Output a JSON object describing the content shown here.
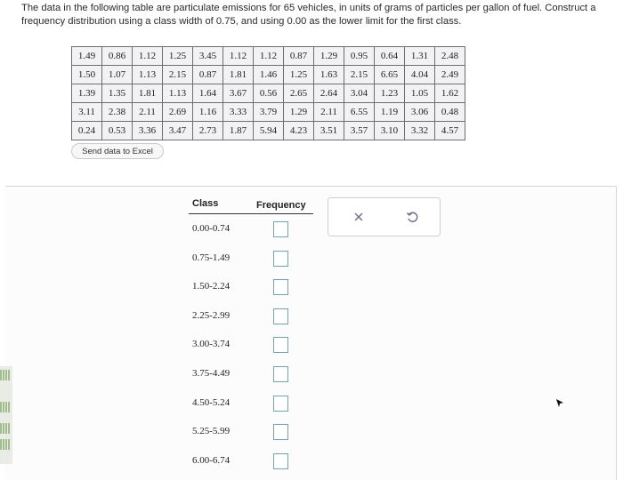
{
  "question_text": "The data in the following table are particulate emissions for 65 vehicles, in units of grams of particles per gallon of fuel. Construct a frequency distribution using a class width of 0.75, and using 0.00 as the lower limit for the first class.",
  "data_rows": [
    [
      "1.49",
      "0.86",
      "1.12",
      "1.25",
      "3.45",
      "1.12",
      "1.12",
      "0.87",
      "1.29",
      "0.95",
      "0.64",
      "1.31",
      "2.48"
    ],
    [
      "1.50",
      "1.07",
      "1.13",
      "2.15",
      "0.87",
      "1.81",
      "1.46",
      "1.25",
      "1.63",
      "2.15",
      "6.65",
      "4.04",
      "2.49"
    ],
    [
      "1.39",
      "1.35",
      "1.81",
      "1.13",
      "1.64",
      "3.67",
      "0.56",
      "2.65",
      "2.64",
      "3.04",
      "1.23",
      "1.05",
      "1.62"
    ],
    [
      "3.11",
      "2.38",
      "2.11",
      "2.69",
      "1.16",
      "3.33",
      "3.79",
      "1.29",
      "2.11",
      "6.55",
      "1.19",
      "3.06",
      "0.48"
    ],
    [
      "0.24",
      "0.53",
      "3.36",
      "3.47",
      "2.73",
      "1.87",
      "5.94",
      "4.23",
      "3.51",
      "3.57",
      "3.10",
      "3.32",
      "4.57"
    ]
  ],
  "excel_button_label": "Send data to Excel",
  "table_headers": {
    "class": "Class",
    "frequency": "Frequency"
  },
  "classes": [
    {
      "label": "0.00-0.74",
      "frequency": ""
    },
    {
      "label": "0.75-1.49",
      "frequency": ""
    },
    {
      "label": "1.50-2.24",
      "frequency": ""
    },
    {
      "label": "2.25-2.99",
      "frequency": ""
    },
    {
      "label": "3.00-3.74",
      "frequency": ""
    },
    {
      "label": "3.75-4.49",
      "frequency": ""
    },
    {
      "label": "4.50-5.24",
      "frequency": ""
    },
    {
      "label": "5.25-5.99",
      "frequency": ""
    },
    {
      "label": "6.00-6.74",
      "frequency": ""
    }
  ],
  "actions": {
    "clear_icon": "close-icon",
    "reset_icon": "undo-icon"
  },
  "colors": {
    "input_border": "#6aa7c6",
    "action_icon": "#6a6a8a"
  }
}
